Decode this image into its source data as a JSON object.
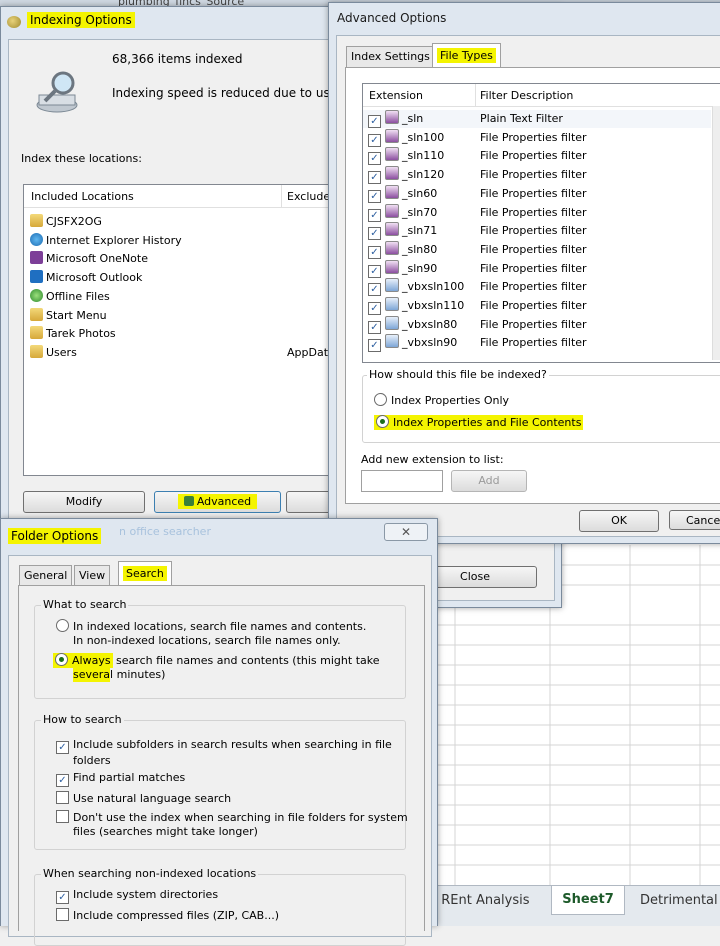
{
  "background": {
    "top_partial_text": "plumbing_fincs_Source",
    "faded_text": "n office searcher",
    "sheet_tabs": [
      "t REnt Analysis",
      "Sheet7",
      "Detrimental"
    ]
  },
  "indexing": {
    "title": "Indexing Options",
    "items_indexed": "68,366 items indexed",
    "status": "Indexing speed is reduced due to user ac",
    "index_these": "Index these locations:",
    "headers": [
      "Included Locations",
      "Exclude"
    ],
    "locations": [
      {
        "name": "CJSFX2OG",
        "icon": "folder-icon",
        "exclude": ""
      },
      {
        "name": "Internet Explorer History",
        "icon": "ie-icon",
        "exclude": ""
      },
      {
        "name": "Microsoft OneNote",
        "icon": "onenote-icon",
        "exclude": ""
      },
      {
        "name": "Microsoft Outlook",
        "icon": "outlook-icon",
        "exclude": ""
      },
      {
        "name": "Offline Files",
        "icon": "offline-files-icon",
        "exclude": ""
      },
      {
        "name": "Start Menu",
        "icon": "folder-icon",
        "exclude": ""
      },
      {
        "name": "Tarek Photos",
        "icon": "folder-icon",
        "exclude": ""
      },
      {
        "name": "Users",
        "icon": "folder-icon",
        "exclude": "AppDat"
      }
    ],
    "modify_label": "Modify",
    "advanced_label": "Advanced",
    "close_label": "Close"
  },
  "advanced": {
    "title": "Advanced Options",
    "tabs": [
      "Index Settings",
      "File Types"
    ],
    "headers": [
      "Extension",
      "Filter Description"
    ],
    "rows": [
      {
        "ext": "_sln",
        "desc": "Plain Text Filter"
      },
      {
        "ext": "_sln100",
        "desc": "File Properties filter"
      },
      {
        "ext": "_sln110",
        "desc": "File Properties filter"
      },
      {
        "ext": "_sln120",
        "desc": "File Properties filter"
      },
      {
        "ext": "_sln60",
        "desc": "File Properties filter"
      },
      {
        "ext": "_sln70",
        "desc": "File Properties filter"
      },
      {
        "ext": "_sln71",
        "desc": "File Properties filter"
      },
      {
        "ext": "_sln80",
        "desc": "File Properties filter"
      },
      {
        "ext": "_sln90",
        "desc": "File Properties filter"
      },
      {
        "ext": "_vbxsln100",
        "desc": "File Properties filter"
      },
      {
        "ext": "_vbxsln110",
        "desc": "File Properties filter"
      },
      {
        "ext": "_vbxsln80",
        "desc": "File Properties filter"
      },
      {
        "ext": "_vbxsln90",
        "desc": "File Properties filter"
      }
    ],
    "how_indexed": "How should this file be indexed?",
    "opt_props": "Index Properties Only",
    "opt_contents": "Index Properties and File Contents",
    "add_ext_label": "Add new extension to list:",
    "add_label": "Add",
    "ok_label": "OK",
    "cancel_label": "Cance"
  },
  "folder": {
    "title": "Folder Options",
    "tabs": [
      "General",
      "View",
      "Search"
    ],
    "what_to_search": "What to search",
    "opt1_line1": "In indexed locations, search file names and contents.",
    "opt1_line2": "In non-indexed locations, search file names only.",
    "opt2_word": "Always",
    "opt2_rest": " search file names and contents (this might take",
    "opt2_line2a": "severa",
    "opt2_line2b": "l minutes)",
    "how_to_search": "How to search",
    "how_items": [
      {
        "line1": "Include subfolders in search results when searching in file",
        "line2": "folders",
        "checked": true
      },
      {
        "line1": "Find partial matches",
        "line2": "",
        "checked": true
      },
      {
        "line1": "Use natural language search",
        "line2": "",
        "checked": false
      },
      {
        "line1": "Don't use the index when searching in file folders for system",
        "line2": "files (searches might take longer)",
        "checked": false
      }
    ],
    "nonindexed": "When searching non-indexed locations",
    "non_items": [
      {
        "label": "Include system directories",
        "checked": true
      },
      {
        "label": "Include compressed files (ZIP, CAB...)",
        "checked": false
      }
    ]
  },
  "colors": {
    "highlight": "#f4f400",
    "title_bar": "#dfe7f0"
  }
}
